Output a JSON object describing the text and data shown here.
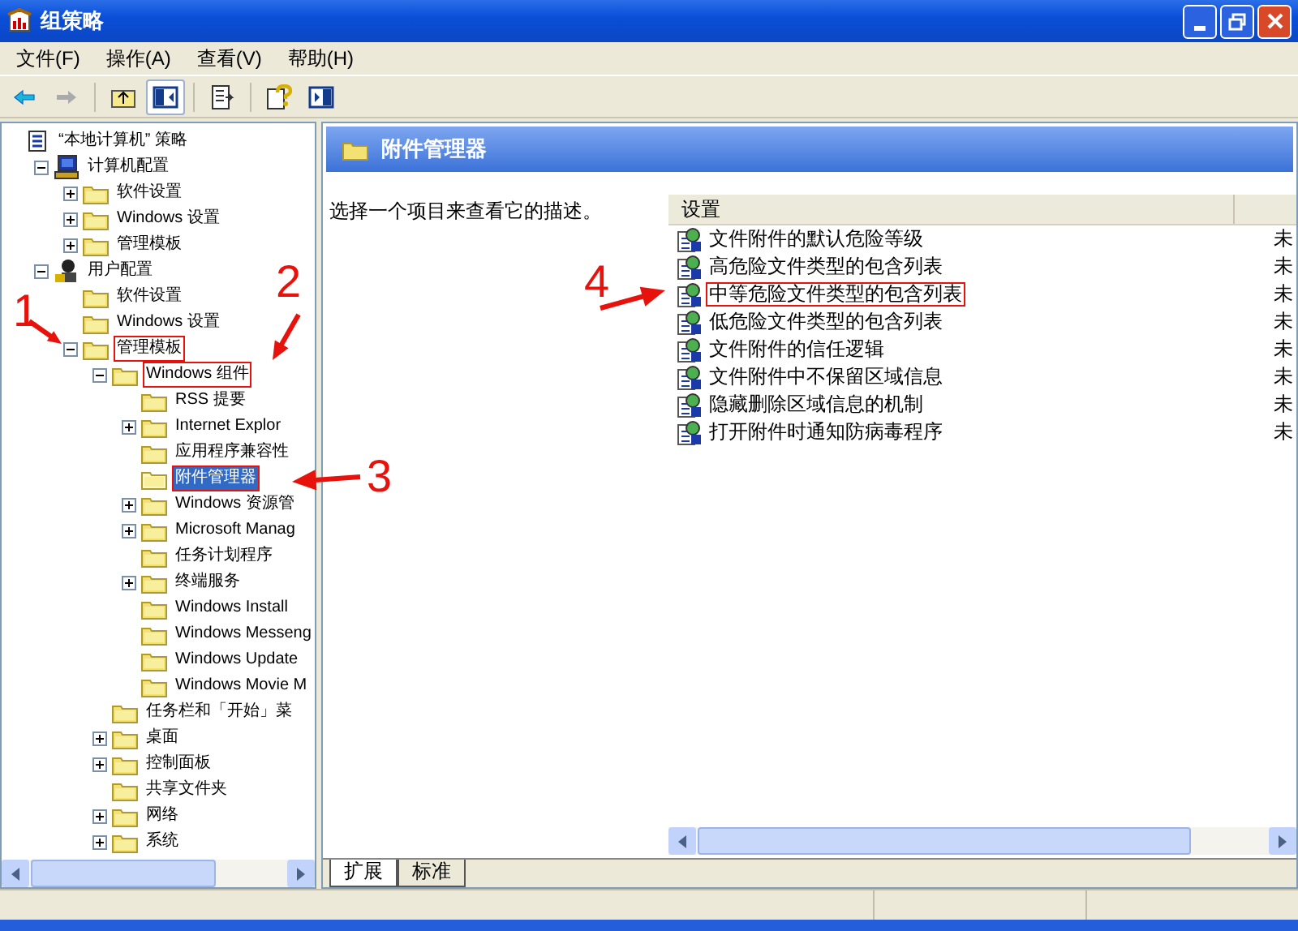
{
  "window": {
    "title": "组策略"
  },
  "menu": [
    "文件(F)",
    "操作(A)",
    "查看(V)",
    "帮助(H)"
  ],
  "tree": [
    {
      "label": "“本地计算机” 策略",
      "kind": "policy",
      "selected": false,
      "highlighted": false,
      "children": [
        {
          "label": "计算机配置",
          "kind": "computer",
          "expanded": true,
          "selected": false,
          "highlighted": false,
          "children": [
            {
              "label": "软件设置",
              "kind": "folder",
              "expanded": false,
              "selected": false,
              "highlighted": false
            },
            {
              "label": "Windows 设置",
              "kind": "folder",
              "expanded": false,
              "selected": false,
              "highlighted": false
            },
            {
              "label": "管理模板",
              "kind": "folder",
              "expanded": false,
              "selected": false,
              "highlighted": false
            }
          ]
        },
        {
          "label": "用户配置",
          "kind": "user",
          "expanded": true,
          "selected": false,
          "highlighted": false,
          "children": [
            {
              "label": "软件设置",
              "kind": "folder",
              "selected": false,
              "highlighted": false
            },
            {
              "label": "Windows 设置",
              "kind": "folder",
              "selected": false,
              "highlighted": false
            },
            {
              "label": "管理模板",
              "kind": "folder",
              "expanded": true,
              "selected": false,
              "highlighted": true,
              "children": [
                {
                  "label": "Windows 组件",
                  "kind": "folder",
                  "expanded": true,
                  "selected": false,
                  "highlighted": true,
                  "children": [
                    {
                      "label": "RSS 提要",
                      "kind": "folder",
                      "selected": false,
                      "highlighted": false
                    },
                    {
                      "label": "Internet Explor",
                      "kind": "folder",
                      "expanded": false,
                      "selected": false,
                      "highlighted": false
                    },
                    {
                      "label": "应用程序兼容性",
                      "kind": "folder",
                      "selected": false,
                      "highlighted": false
                    },
                    {
                      "label": "附件管理器",
                      "kind": "folder",
                      "selected": true,
                      "highlighted": true
                    },
                    {
                      "label": "Windows 资源管",
                      "kind": "folder",
                      "expanded": false,
                      "selected": false,
                      "highlighted": false
                    },
                    {
                      "label": "Microsoft Manag",
                      "kind": "folder",
                      "expanded": false,
                      "selected": false,
                      "highlighted": false
                    },
                    {
                      "label": "任务计划程序",
                      "kind": "folder",
                      "selected": false,
                      "highlighted": false
                    },
                    {
                      "label": "终端服务",
                      "kind": "folder",
                      "expanded": false,
                      "selected": false,
                      "highlighted": false
                    },
                    {
                      "label": "Windows Install",
                      "kind": "folder",
                      "selected": false,
                      "highlighted": false
                    },
                    {
                      "label": "Windows Messeng",
                      "kind": "folder",
                      "selected": false,
                      "highlighted": false
                    },
                    {
                      "label": "Windows Update",
                      "kind": "folder",
                      "selected": false,
                      "highlighted": false
                    },
                    {
                      "label": "Windows Movie M",
                      "kind": "folder",
                      "selected": false,
                      "highlighted": false
                    }
                  ]
                },
                {
                  "label": "任务栏和「开始」菜",
                  "kind": "folder",
                  "selected": false,
                  "highlighted": false
                },
                {
                  "label": "桌面",
                  "kind": "folder",
                  "expanded": false,
                  "selected": false,
                  "highlighted": false
                },
                {
                  "label": "控制面板",
                  "kind": "folder",
                  "expanded": false,
                  "selected": false,
                  "highlighted": false
                },
                {
                  "label": "共享文件夹",
                  "kind": "folder",
                  "selected": false,
                  "highlighted": false
                },
                {
                  "label": "网络",
                  "kind": "folder",
                  "expanded": false,
                  "selected": false,
                  "highlighted": false
                },
                {
                  "label": "系统",
                  "kind": "folder",
                  "expanded": false,
                  "selected": false,
                  "highlighted": false
                }
              ]
            }
          ]
        }
      ]
    }
  ],
  "details": {
    "title": "附件管理器",
    "description": "选择一个项目来查看它的描述。"
  },
  "list": {
    "columns": [
      "设置"
    ],
    "rows": [
      {
        "name": "文件附件的默认危险等级",
        "column_2": "未",
        "highlighted": false
      },
      {
        "name": "高危险文件类型的包含列表",
        "column_2": "未",
        "highlighted": false
      },
      {
        "name": "中等危险文件类型的包含列表",
        "column_2": "未",
        "highlighted": true
      },
      {
        "name": "低危险文件类型的包含列表",
        "column_2": "未",
        "highlighted": false
      },
      {
        "name": "文件附件的信任逻辑",
        "column_2": "未",
        "highlighted": false
      },
      {
        "name": "文件附件中不保留区域信息",
        "column_2": "未",
        "highlighted": false
      },
      {
        "name": "隐藏删除区域信息的机制",
        "column_2": "未",
        "highlighted": false
      },
      {
        "name": "打开附件时通知防病毒程序",
        "column_2": "未",
        "highlighted": false
      }
    ]
  },
  "tabs": [
    {
      "label": "扩展",
      "selected": true
    },
    {
      "label": "标准",
      "selected": false
    }
  ],
  "annotations": [
    {
      "label": "1"
    },
    {
      "label": "2"
    },
    {
      "label": "3"
    },
    {
      "label": "4"
    }
  ]
}
